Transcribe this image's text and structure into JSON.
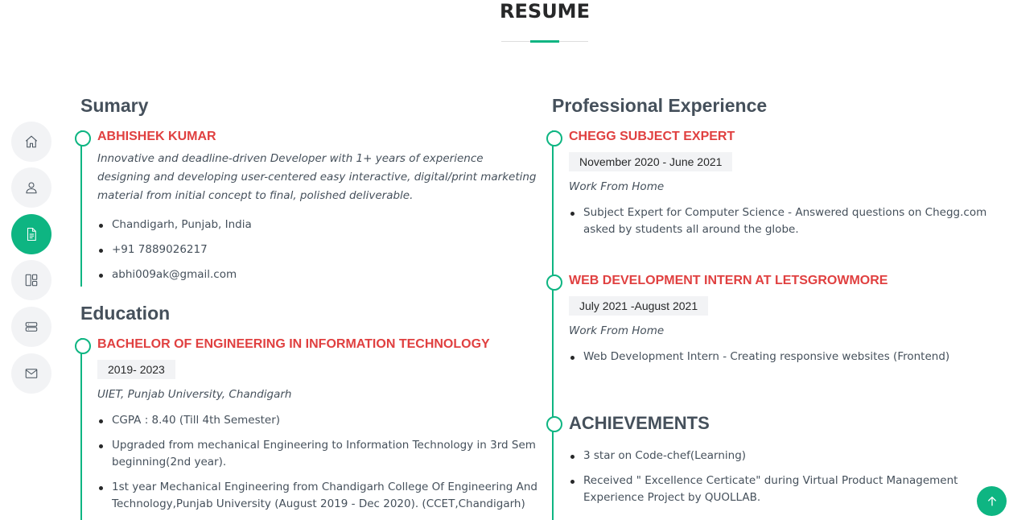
{
  "page": {
    "title": "RESUME"
  },
  "colors": {
    "accent": "#0eb582",
    "heading_red": "#e04040",
    "heading_dark": "#45505b",
    "nav_bg": "#f2f3f5"
  },
  "side_nav": [
    {
      "icon": "home-icon",
      "active": false
    },
    {
      "icon": "user-icon",
      "active": false
    },
    {
      "icon": "document-icon",
      "active": true
    },
    {
      "icon": "portfolio-icon",
      "active": false
    },
    {
      "icon": "server-icon",
      "active": false
    },
    {
      "icon": "envelope-icon",
      "active": false
    }
  ],
  "summary": {
    "title": "Sumary",
    "name": "ABHISHEK KUMAR",
    "description": "Innovative and deadline-driven Developer with 1+ years of experience designing and developing user-centered easy interactive, digital/print marketing material from initial concept to final, polished deliverable.",
    "details": [
      "Chandigarh, Punjab, India",
      "+91 7889026217",
      "abhi009ak@gmail.com"
    ]
  },
  "education": {
    "title": "Education",
    "items": [
      {
        "degree": "BACHELOR OF ENGINEERING IN INFORMATION TECHNOLOGY",
        "years": "2019- 2023",
        "institution": "UIET, Punjab University, Chandigarh",
        "points": [
          "CGPA : 8.40 (Till 4th Semester)",
          "Upgraded from mechanical Engineering to Information Technology in 3rd Sem beginning(2nd year).",
          "1st year Mechanical Engineering from Chandigarh College Of Engineering And Technology,Punjab University (August 2019 - Dec 2020). (CCET,Chandigarh)"
        ]
      }
    ]
  },
  "experience": {
    "title": "Professional Experience",
    "items": [
      {
        "role": "CHEGG SUBJECT EXPERT",
        "period": "November 2020 - June 2021",
        "location": "Work From Home",
        "points": [
          "Subject Expert for Computer Science - Answered questions on Chegg.com asked by students all around the globe."
        ]
      },
      {
        "role": "WEB DEVELOPMENT INTERN AT LETSGROWMORE",
        "period": "July 2021 -August 2021",
        "location": "Work From Home",
        "points": [
          "Web Development Intern - Creating responsive websites (Frontend)"
        ]
      }
    ]
  },
  "achievements": {
    "title": "ACHIEVEMENTS",
    "points": [
      "3 star on Code-chef(Learning)",
      "Received \" Excellence Certicate\" during Virtual Product Management Experience Project by QUOLLAB."
    ]
  },
  "back_to_top": {
    "icon": "arrow-up-icon"
  }
}
